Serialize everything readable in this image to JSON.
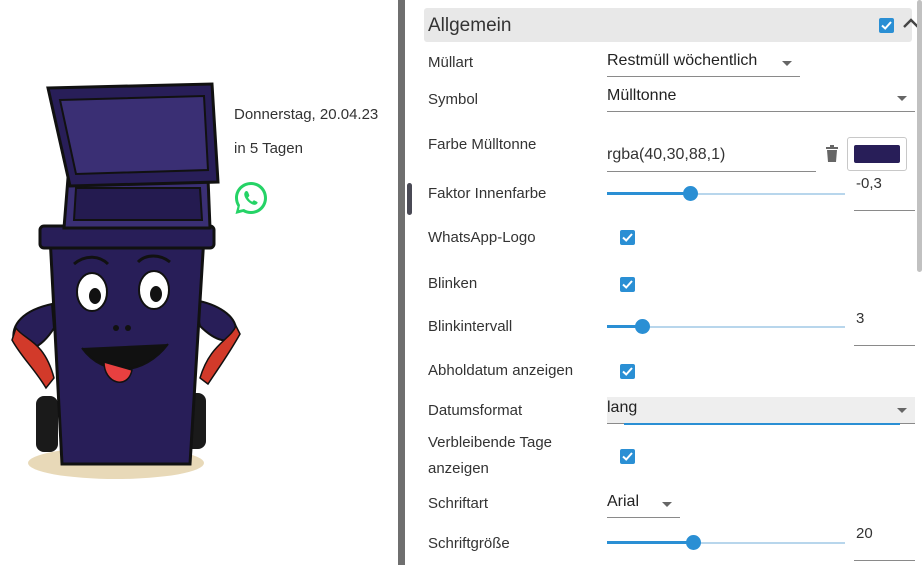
{
  "preview": {
    "date_text": "Donnerstag, 20.04.23",
    "remaining_text": "in 5 Tagen",
    "bin_color": "#28 1e58",
    "whatsapp_color": "#25d366"
  },
  "panel": {
    "section_title": "Allgemein",
    "section_enabled": true,
    "accent_color": "#2a8fd4",
    "rows": {
      "muellart": {
        "label": "Müllart",
        "value": "Restmüll wöchentlich"
      },
      "symbol": {
        "label": "Symbol",
        "value": "Mülltonne"
      },
      "farbe": {
        "label": "Farbe Mülltonne",
        "value": "rgba(40,30,88,1)",
        "swatch": "#281e58"
      },
      "faktor": {
        "label": "Faktor Innenfarbe",
        "value": "-0,3"
      },
      "whatsapp": {
        "label": "WhatsApp-Logo",
        "checked": true
      },
      "blinken": {
        "label": "Blinken",
        "checked": true
      },
      "blinkintervall": {
        "label": "Blinkintervall",
        "value": "3"
      },
      "abholdatum": {
        "label": "Abholdatum anzeigen",
        "checked": true
      },
      "datumsformat": {
        "label": "Datumsformat",
        "value": "lang"
      },
      "verbleibende": {
        "label_line1": "Verbleibende Tage",
        "label_line2": "anzeigen",
        "checked": true
      },
      "schriftart": {
        "label": "Schriftart",
        "value": "Arial"
      },
      "schriftgroesse": {
        "label": "Schriftgröße",
        "value": "20"
      }
    }
  }
}
